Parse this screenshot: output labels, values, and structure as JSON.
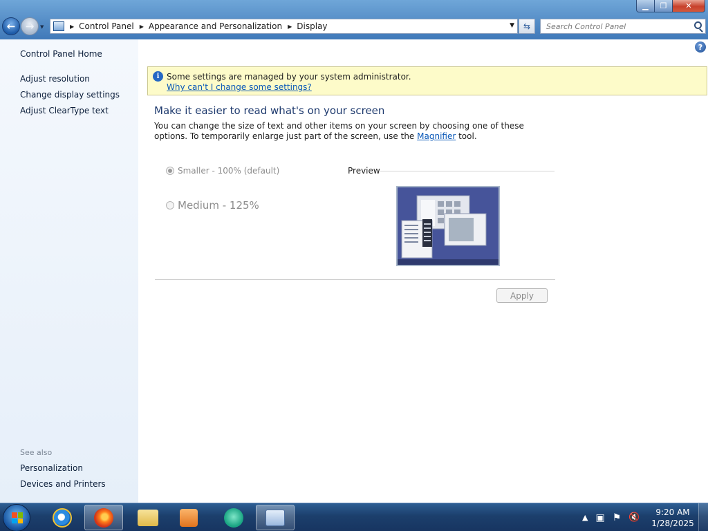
{
  "address": {
    "crumbs": [
      "Control Panel",
      "Appearance and Personalization",
      "Display"
    ],
    "search_placeholder": "Search Control Panel"
  },
  "sidebar": {
    "home": "Control Panel Home",
    "links": [
      "Adjust resolution",
      "Change display settings",
      "Adjust ClearType text"
    ],
    "see_also_label": "See also",
    "see_also": [
      "Personalization",
      "Devices and Printers"
    ]
  },
  "info": {
    "message": "Some settings are managed by your system administrator.",
    "link": "Why can't I change some settings?"
  },
  "main": {
    "heading": "Make it easier to read what's on your screen",
    "desc_before": "You can change the size of text and other items on your screen by choosing one of these options. To temporarily enlarge just part of the screen, use the ",
    "desc_link": "Magnifier",
    "desc_after": " tool.",
    "options": [
      {
        "label": "Smaller - 100% (default)",
        "checked": true
      },
      {
        "label": "Medium - 125%",
        "checked": false
      }
    ],
    "preview_label": "Preview",
    "apply": "Apply"
  },
  "taskbar": {
    "time": "9:20 AM",
    "date": "1/28/2025",
    "apps": [
      "internet-explorer-icon",
      "firefox-icon",
      "file-explorer-icon",
      "media-player-icon",
      "chat-icon",
      "display-settings-icon"
    ],
    "tray_icons": [
      "show-hidden-icons",
      "network-icon",
      "action-center-flag-icon",
      "volume-muted-icon"
    ]
  },
  "colors": {
    "link": "#0a58b8",
    "heading": "#1e3a6e",
    "info_bg": "#fdfbc9",
    "taskbar": "#1c3f6c"
  }
}
